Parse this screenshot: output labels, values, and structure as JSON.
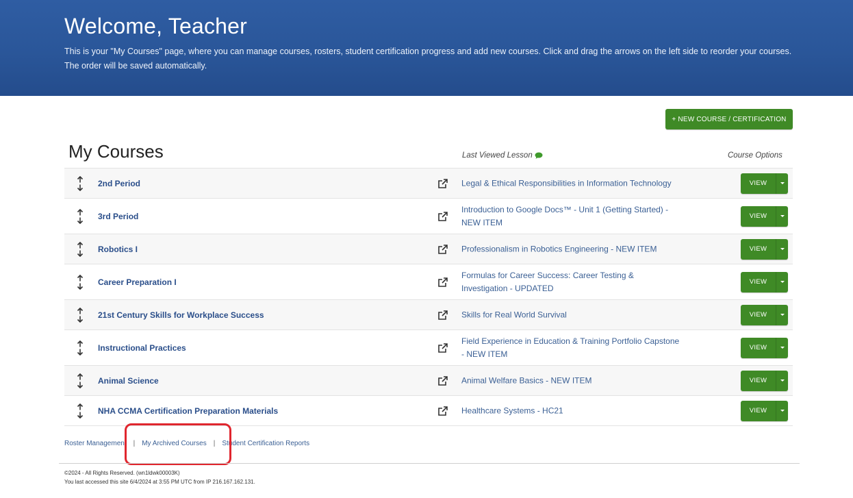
{
  "header": {
    "title": "Welcome, Teacher",
    "description": "This is your \"My Courses\" page, where you can manage courses, rosters, student certification progress and add new courses. Click and drag the arrows on the left side to reorder your courses. The order will be saved automatically."
  },
  "toolbar": {
    "new_course_label": "+ NEW COURSE / CERTIFICATION"
  },
  "courses_section": {
    "title": "My Courses",
    "col_last_viewed": "Last Viewed Lesson",
    "col_options": "Course Options",
    "view_label": "VIEW",
    "rows": [
      {
        "name": "2nd Period",
        "lesson": "Legal & Ethical Responsibilities in Information Technology"
      },
      {
        "name": "3rd Period",
        "lesson": "Introduction to Google Docs™ - Unit 1 (Getting Started) - NEW ITEM"
      },
      {
        "name": "Robotics I",
        "lesson": "Professionalism in Robotics Engineering - NEW ITEM"
      },
      {
        "name": "Career Preparation I",
        "lesson": "Formulas for Career Success: Career Testing & Investigation - UPDATED"
      },
      {
        "name": "21st Century Skills for Workplace Success",
        "lesson": "Skills for Real World Survival"
      },
      {
        "name": "Instructional Practices",
        "lesson": "Field Experience in Education & Training Portfolio Capstone - NEW ITEM"
      },
      {
        "name": "Animal Science",
        "lesson": "Animal Welfare Basics - NEW ITEM"
      },
      {
        "name": "NHA CCMA Certification Preparation Materials",
        "lesson": "Healthcare Systems - HC21"
      }
    ]
  },
  "footer": {
    "links": [
      "Roster Management",
      "My Archived Courses",
      "Student Certification Reports"
    ],
    "separator": "|",
    "copyright": "©2024 - All Rights Reserved. (wn1ldwk00003K)",
    "last_access": "You last accessed this site 6/4/2024 at 3:55 PM UTC from IP 216.167.162.131."
  },
  "colors": {
    "header_blue": "#2a5699",
    "action_green": "#3f8a26",
    "link_blue": "#2a4e8a",
    "highlight_red": "#e0262e"
  },
  "icons": {
    "reorder": "up-down-arrows-icon",
    "open": "external-link-icon",
    "comment": "chat-bubble-icon",
    "dropdown": "caret-down-icon"
  }
}
